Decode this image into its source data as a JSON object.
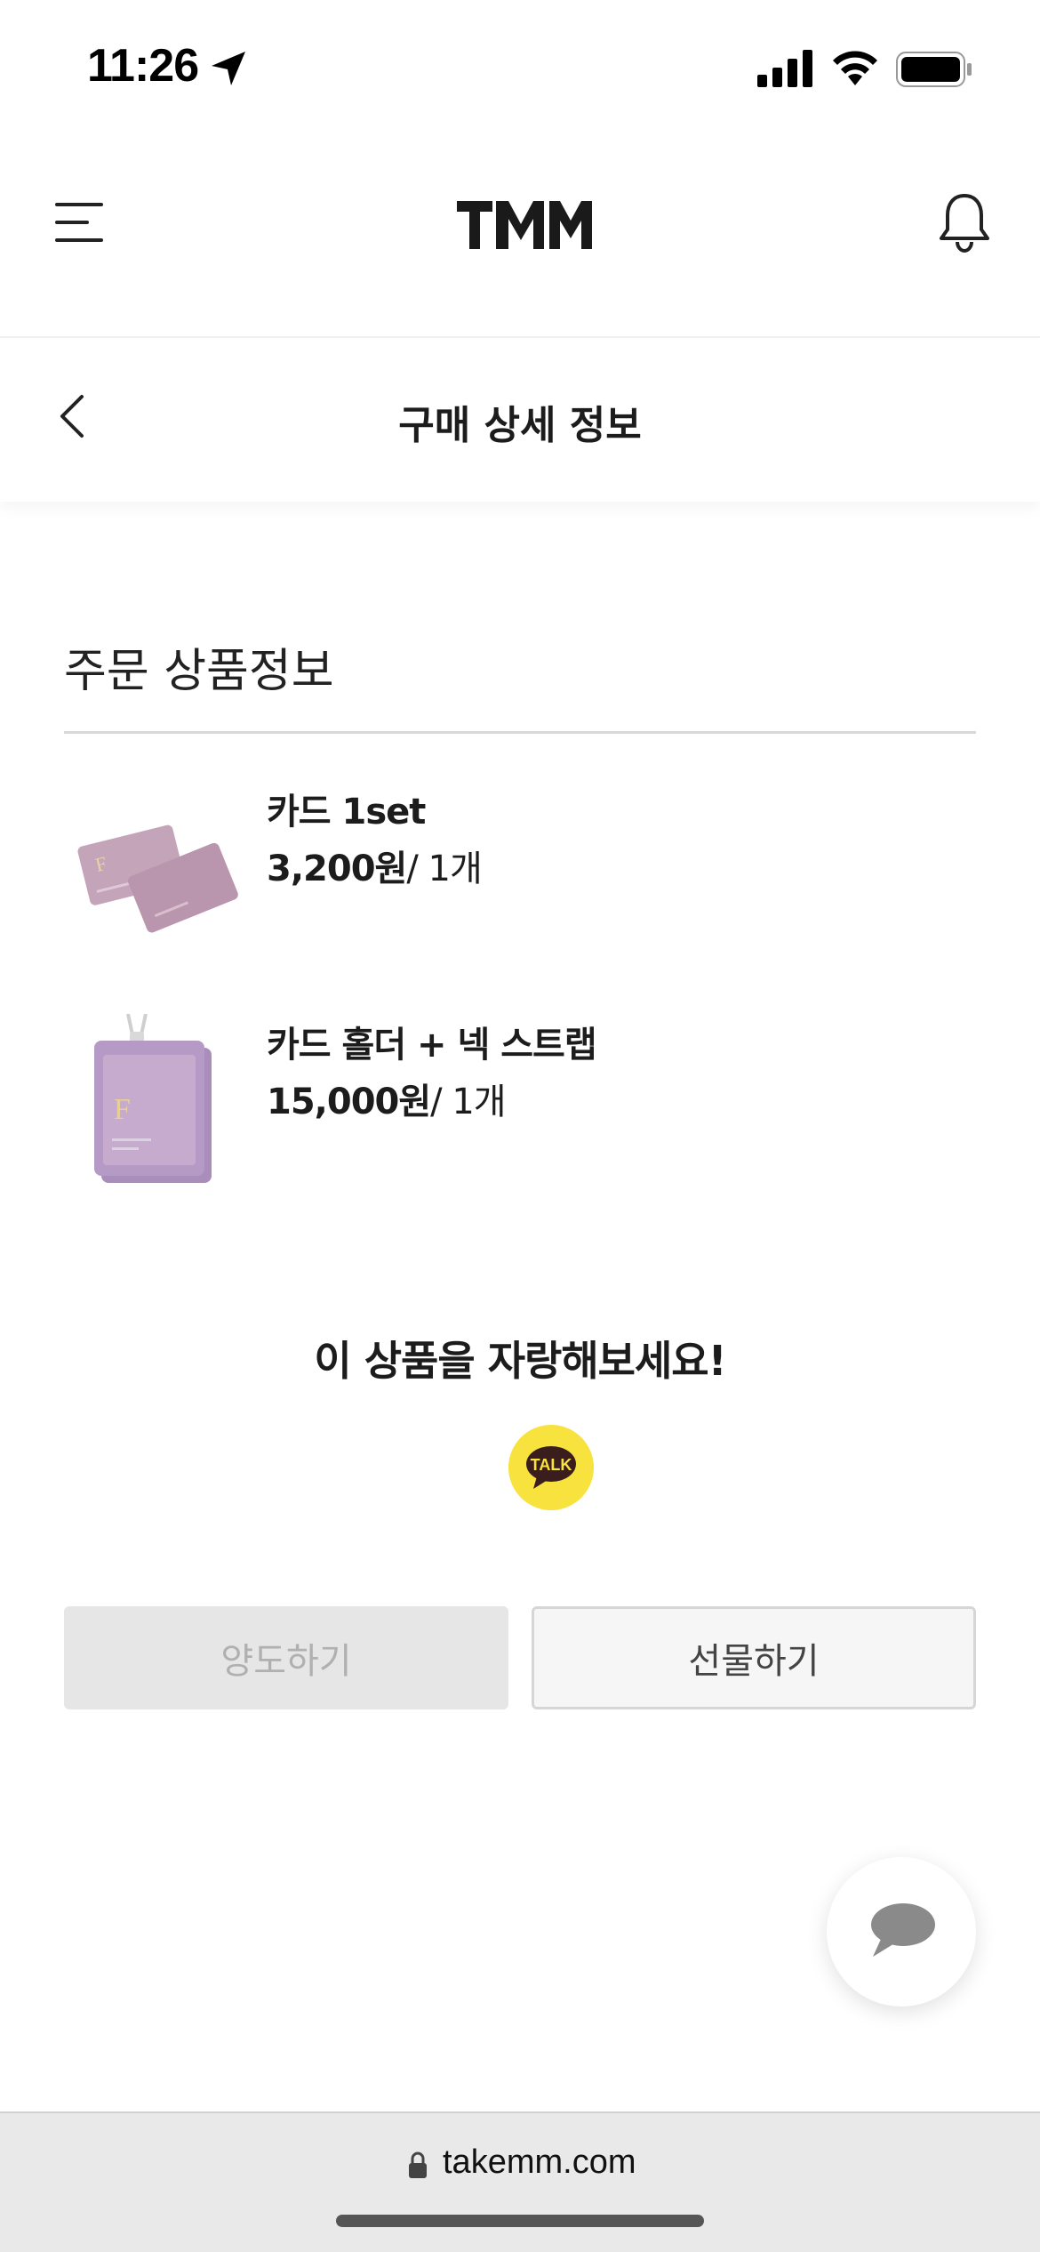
{
  "status_bar": {
    "time": "11:26",
    "icons": [
      "location-arrow-icon",
      "signal-icon",
      "wifi-icon",
      "battery-icon"
    ]
  },
  "header": {
    "logo_text": "TMM",
    "menu_icon": "hamburger-menu-icon",
    "bell_icon": "bell-icon"
  },
  "sub_header": {
    "title": "구매 상세 정보",
    "back_icon": "chevron-left-icon"
  },
  "order": {
    "section_title": "주문 상품정보",
    "products": [
      {
        "name": "카드 1set",
        "price": "3,200원",
        "qty": "/ 1개"
      },
      {
        "name": "카드 홀더 + 넥 스트랩",
        "price": "15,000원",
        "qty": "/ 1개"
      }
    ]
  },
  "share": {
    "text": "이 상품을 자랑해보세요!",
    "kakao_label": "TALK"
  },
  "actions": {
    "transfer_label": "양도하기",
    "gift_label": "선물하기"
  },
  "browser": {
    "url": "takemm.com"
  },
  "colors": {
    "kakao_yellow": "#f7e23e",
    "card_purple": "#b49ab8",
    "disabled_bg": "#e6e6e6",
    "disabled_text": "#b0b0b0"
  }
}
